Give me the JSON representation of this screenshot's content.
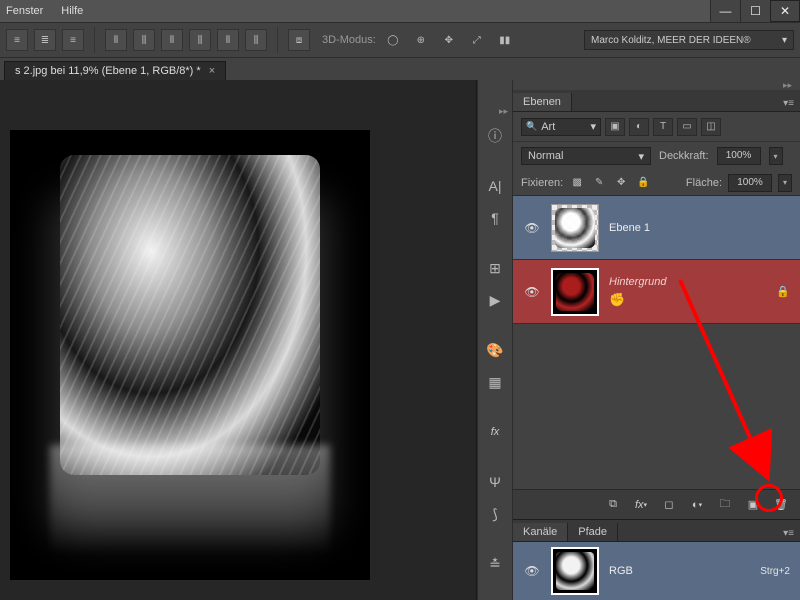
{
  "menu": {
    "fenster": "Fenster",
    "hilfe": "Hilfe"
  },
  "modelabel": "3D-Modus:",
  "user_dd": "Marco Kolditz, MEER DER IDEEN®",
  "doc_tab": "s 2.jpg bei 11,9% (Ebene 1, RGB/8*) *",
  "panel": {
    "tab_layers": "Ebenen",
    "kind": "Art",
    "blend": "Normal",
    "opacity_lbl": "Deckkraft:",
    "opacity_val": "100%",
    "lock_lbl": "Fixieren:",
    "fill_lbl": "Fläche:",
    "fill_val": "100%"
  },
  "layers": {
    "l1": "Ebene 1",
    "bg": "Hintergrund"
  },
  "channels": {
    "tab1": "Kanäle",
    "tab2": "Pfade",
    "rgb": "RGB",
    "shortcut": "Strg+2"
  }
}
